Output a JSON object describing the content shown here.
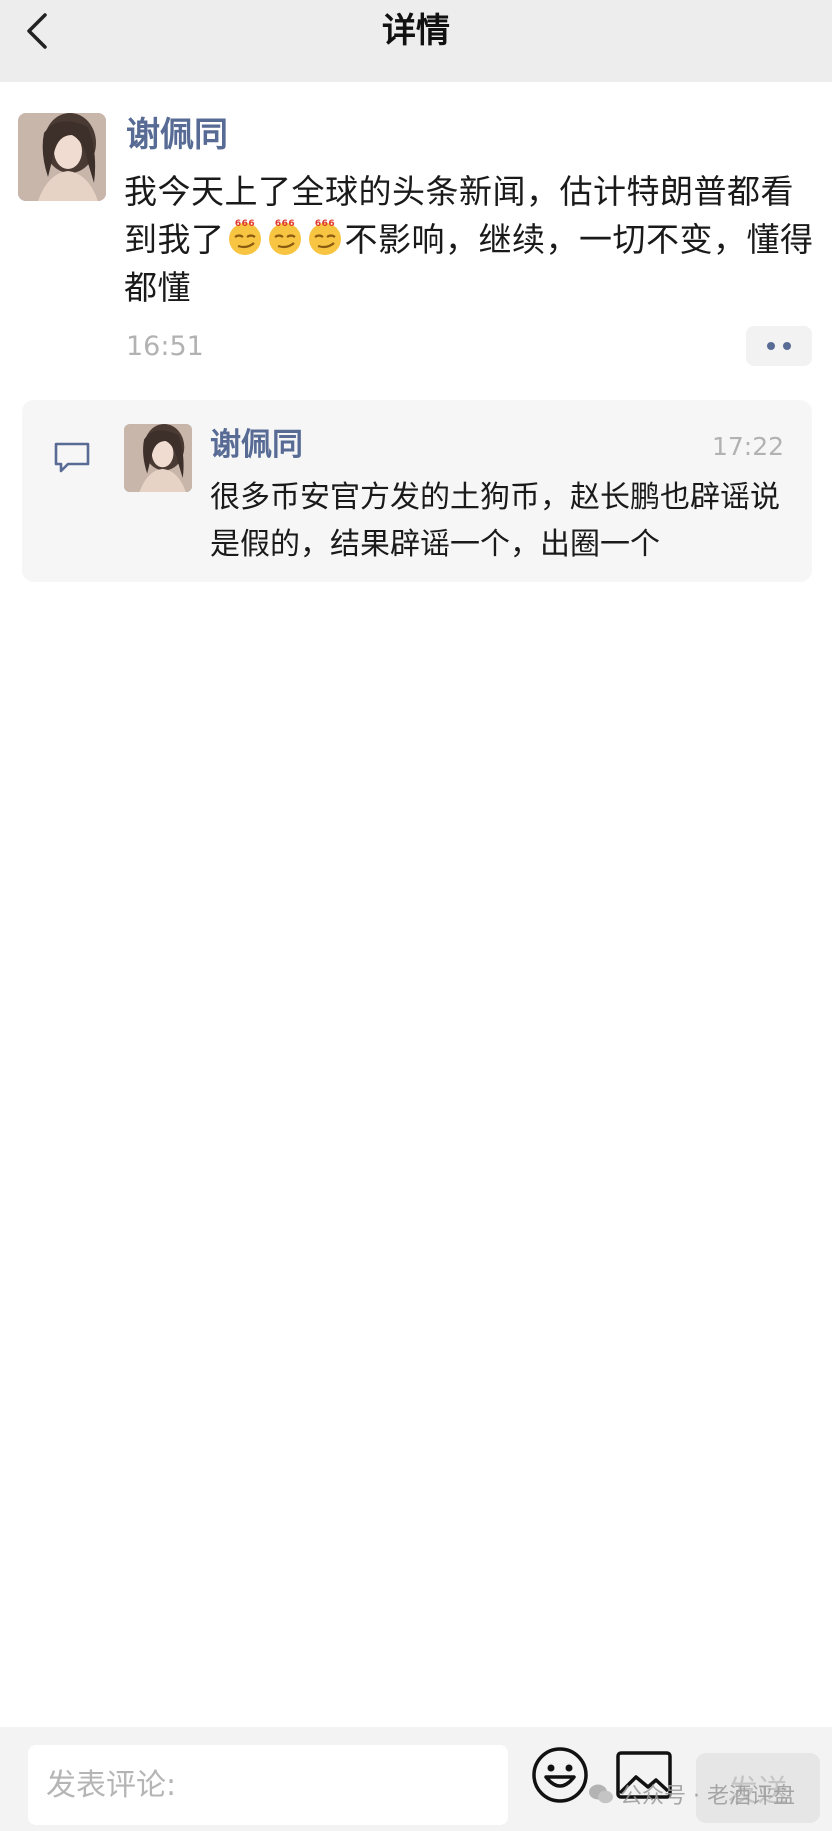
{
  "header": {
    "title": "详情",
    "back_icon": "chevron-left-icon"
  },
  "post": {
    "author": "谢佩同",
    "text_part1": "我今天上了全球的头条新闻，估计特朗普都看到我了",
    "emoji_text": "666",
    "text_part2": "不影响，继续，一切不变，懂得都懂",
    "time": "16:51",
    "more_icon": "more-dots-icon"
  },
  "comment": {
    "icon": "comment-bubble-icon",
    "author": "谢佩同",
    "time": "17:22",
    "text": "很多币安官方发的土狗币，赵长鹏也辟谣说是假的，结果辟谣一个，出圈一个"
  },
  "input_bar": {
    "placeholder": "发表评论:",
    "emoji_icon": "smiley-icon",
    "image_icon": "image-icon",
    "send_label": "发送"
  },
  "watermark": {
    "text": "公众号 · 老酒评盘",
    "icon": "wechat-icon"
  },
  "colors": {
    "name_link": "#576b95",
    "timestamp": "#b2b2b2",
    "topbar_bg": "#ededed",
    "comment_bg": "#f6f6f6"
  }
}
